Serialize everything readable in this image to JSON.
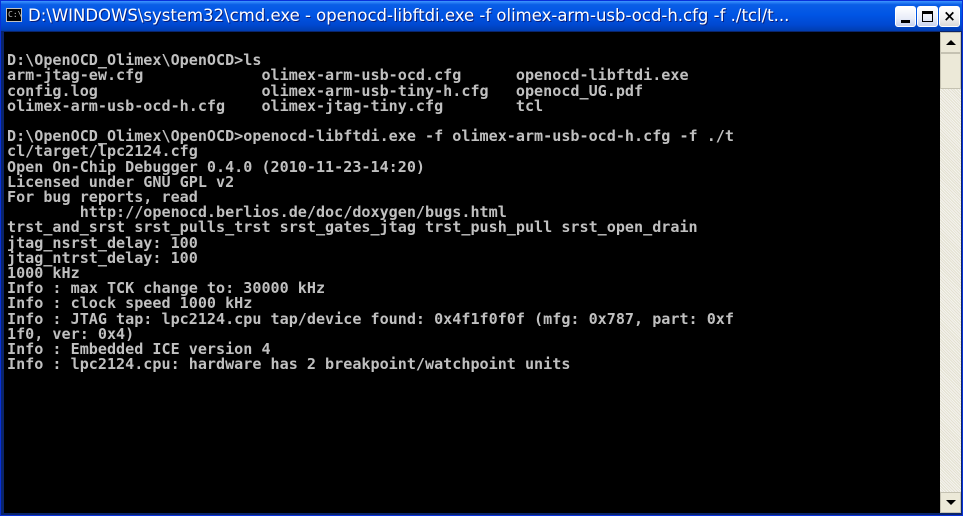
{
  "window": {
    "title": "D:\\WINDOWS\\system32\\cmd.exe - openocd-libftdi.exe -f olimex-arm-usb-ocd-h.cfg -f ./tcl/t...",
    "icon_text": "C:\\",
    "icon": "cmd-console-icon",
    "accent_color": "#0055e5",
    "controls": {
      "minimize": "minimize-icon",
      "maximize": "maximize-icon",
      "close_label": "×",
      "close": "close-icon"
    }
  },
  "console": {
    "background": "#000000",
    "text_color": "#c0c0c0",
    "lines": [
      "",
      "D:\\OpenOCD_Olimex\\OpenOCD>ls",
      "arm-jtag-ew.cfg             olimex-arm-usb-ocd.cfg      openocd-libftdi.exe",
      "config.log                  olimex-arm-usb-tiny-h.cfg   openocd_UG.pdf",
      "olimex-arm-usb-ocd-h.cfg    olimex-jtag-tiny.cfg        tcl",
      "",
      "D:\\OpenOCD_Olimex\\OpenOCD>openocd-libftdi.exe -f olimex-arm-usb-ocd-h.cfg -f ./t",
      "cl/target/lpc2124.cfg",
      "Open On-Chip Debugger 0.4.0 (2010-11-23-14:20)",
      "Licensed under GNU GPL v2",
      "For bug reports, read",
      "        http://openocd.berlios.de/doc/doxygen/bugs.html",
      "trst_and_srst srst_pulls_trst srst_gates_jtag trst_push_pull srst_open_drain",
      "jtag_nsrst_delay: 100",
      "jtag_ntrst_delay: 100",
      "1000 kHz",
      "Info : max TCK change to: 30000 kHz",
      "Info : clock speed 1000 kHz",
      "Info : JTAG tap: lpc2124.cpu tap/device found: 0x4f1f0f0f (mfg: 0x787, part: 0xf",
      "1f0, ver: 0x4)",
      "Info : Embedded ICE version 4",
      "Info : lpc2124.cpu: hardware has 2 breakpoint/watchpoint units"
    ]
  },
  "scrollbar": {
    "up": "scroll-up-arrow-icon",
    "down": "scroll-down-arrow-icon"
  }
}
